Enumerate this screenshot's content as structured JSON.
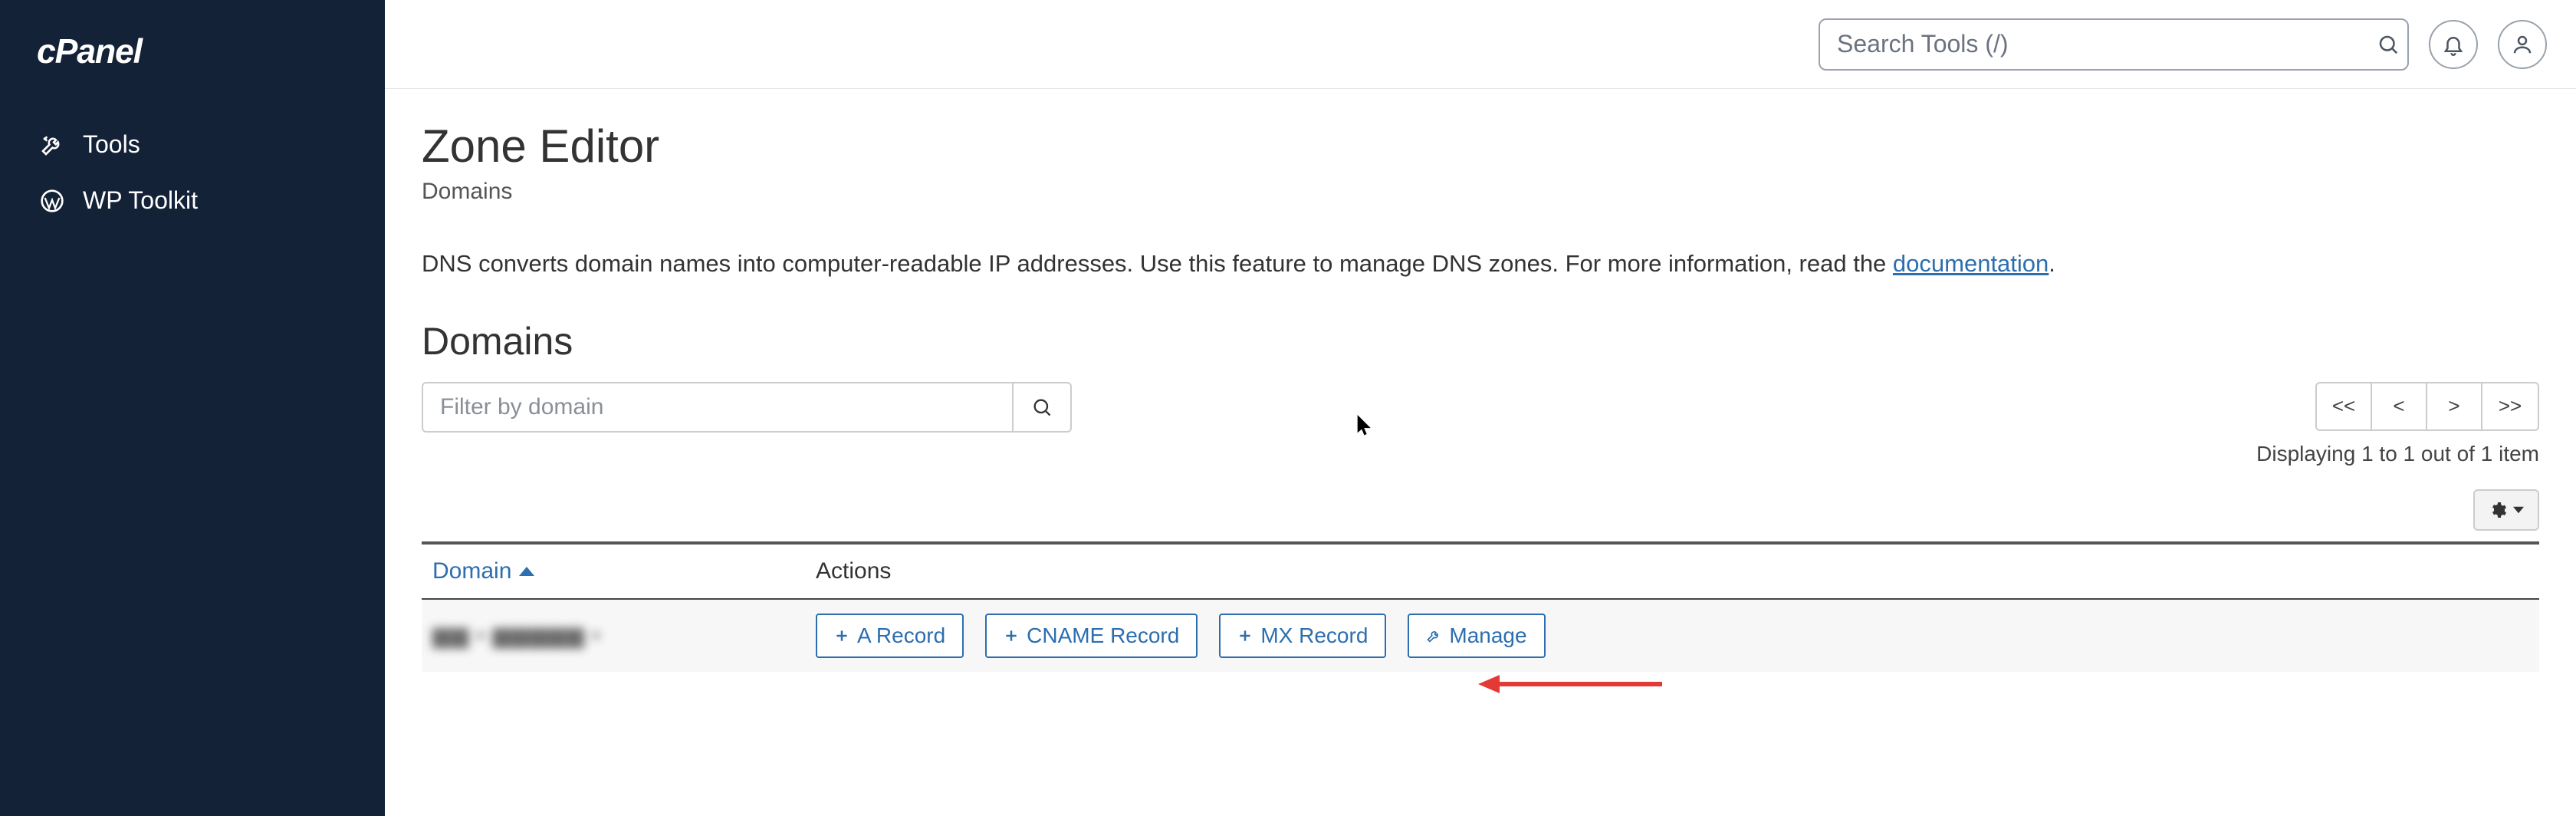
{
  "brand": {
    "name": "cPanel"
  },
  "sidebar": {
    "items": [
      {
        "label": "Tools"
      },
      {
        "label": "WP Toolkit"
      }
    ]
  },
  "header": {
    "search_placeholder": "Search Tools (/)"
  },
  "page": {
    "title": "Zone Editor",
    "subtitle": "Domains",
    "description_prefix": "DNS converts domain names into computer-readable IP addresses. Use this feature to manage DNS zones. For more information, read the ",
    "documentation_label": "documentation",
    "description_suffix": "."
  },
  "section": {
    "title": "Domains",
    "filter_placeholder": "Filter by domain",
    "pager": {
      "first": "<<",
      "prev": "<",
      "next": ">",
      "last": ">>"
    },
    "pager_label": "Displaying 1 to 1 out of 1 item"
  },
  "table": {
    "columns": {
      "domain": "Domain",
      "actions": "Actions"
    },
    "rows": [
      {
        "domain_redacted": "▆▆ ▪ ▆▆▆▆▆ ▪",
        "actions": {
          "a_record": "A Record",
          "cname_record": "CNAME Record",
          "mx_record": "MX Record",
          "manage": "Manage"
        }
      }
    ]
  }
}
